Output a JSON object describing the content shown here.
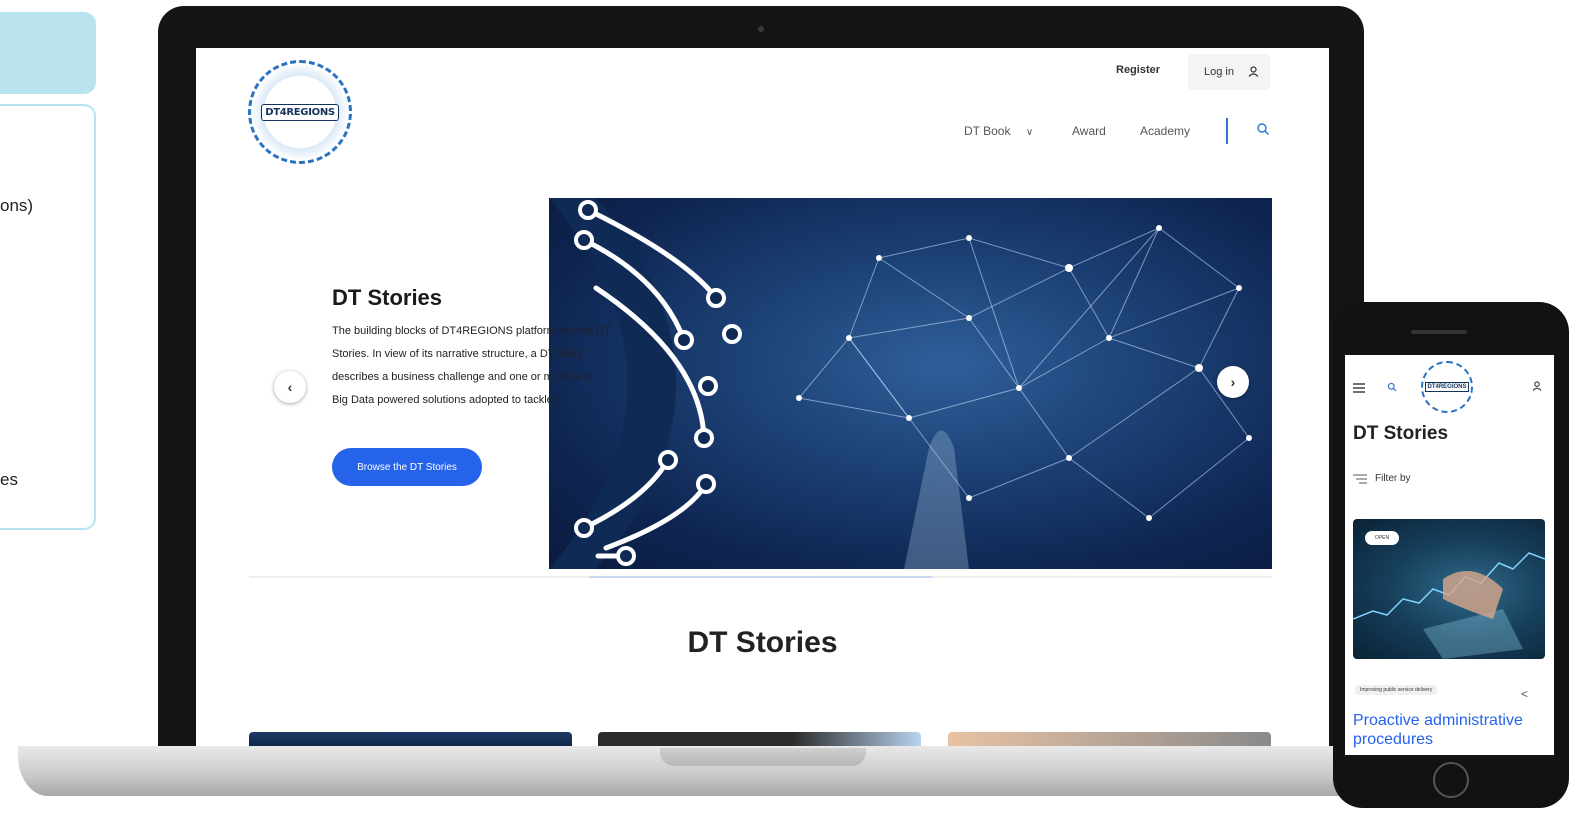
{
  "left_panel": {
    "text1": "ons)",
    "text2": "es"
  },
  "site": {
    "logo": "DT4REGIONS",
    "register": "Register",
    "login": "Log in",
    "nav": [
      "DT Book",
      "Award",
      "Academy"
    ]
  },
  "hero": {
    "title": "DT Stories",
    "description": "The building blocks of DT4REGIONS platform are the DT Stories. In view of its narrative structure, a DT Story describes a business challenge and one or more AI or Big Data powered solutions adopted to tackle it.",
    "button": "Browse the DT Stories",
    "prev": "‹",
    "next": "›"
  },
  "section": {
    "title": "DT Stories"
  },
  "mobile": {
    "logo": "DT4REGIONS",
    "title": "DT Stories",
    "filter": "Filter by",
    "badge": "OPEN",
    "tag": "Improving public service delivery",
    "card_title": "Proactive administrative procedures"
  },
  "colors": {
    "primary": "#2563eb",
    "panel": "#b9e3ef",
    "hero_dark": "#0e2450"
  }
}
